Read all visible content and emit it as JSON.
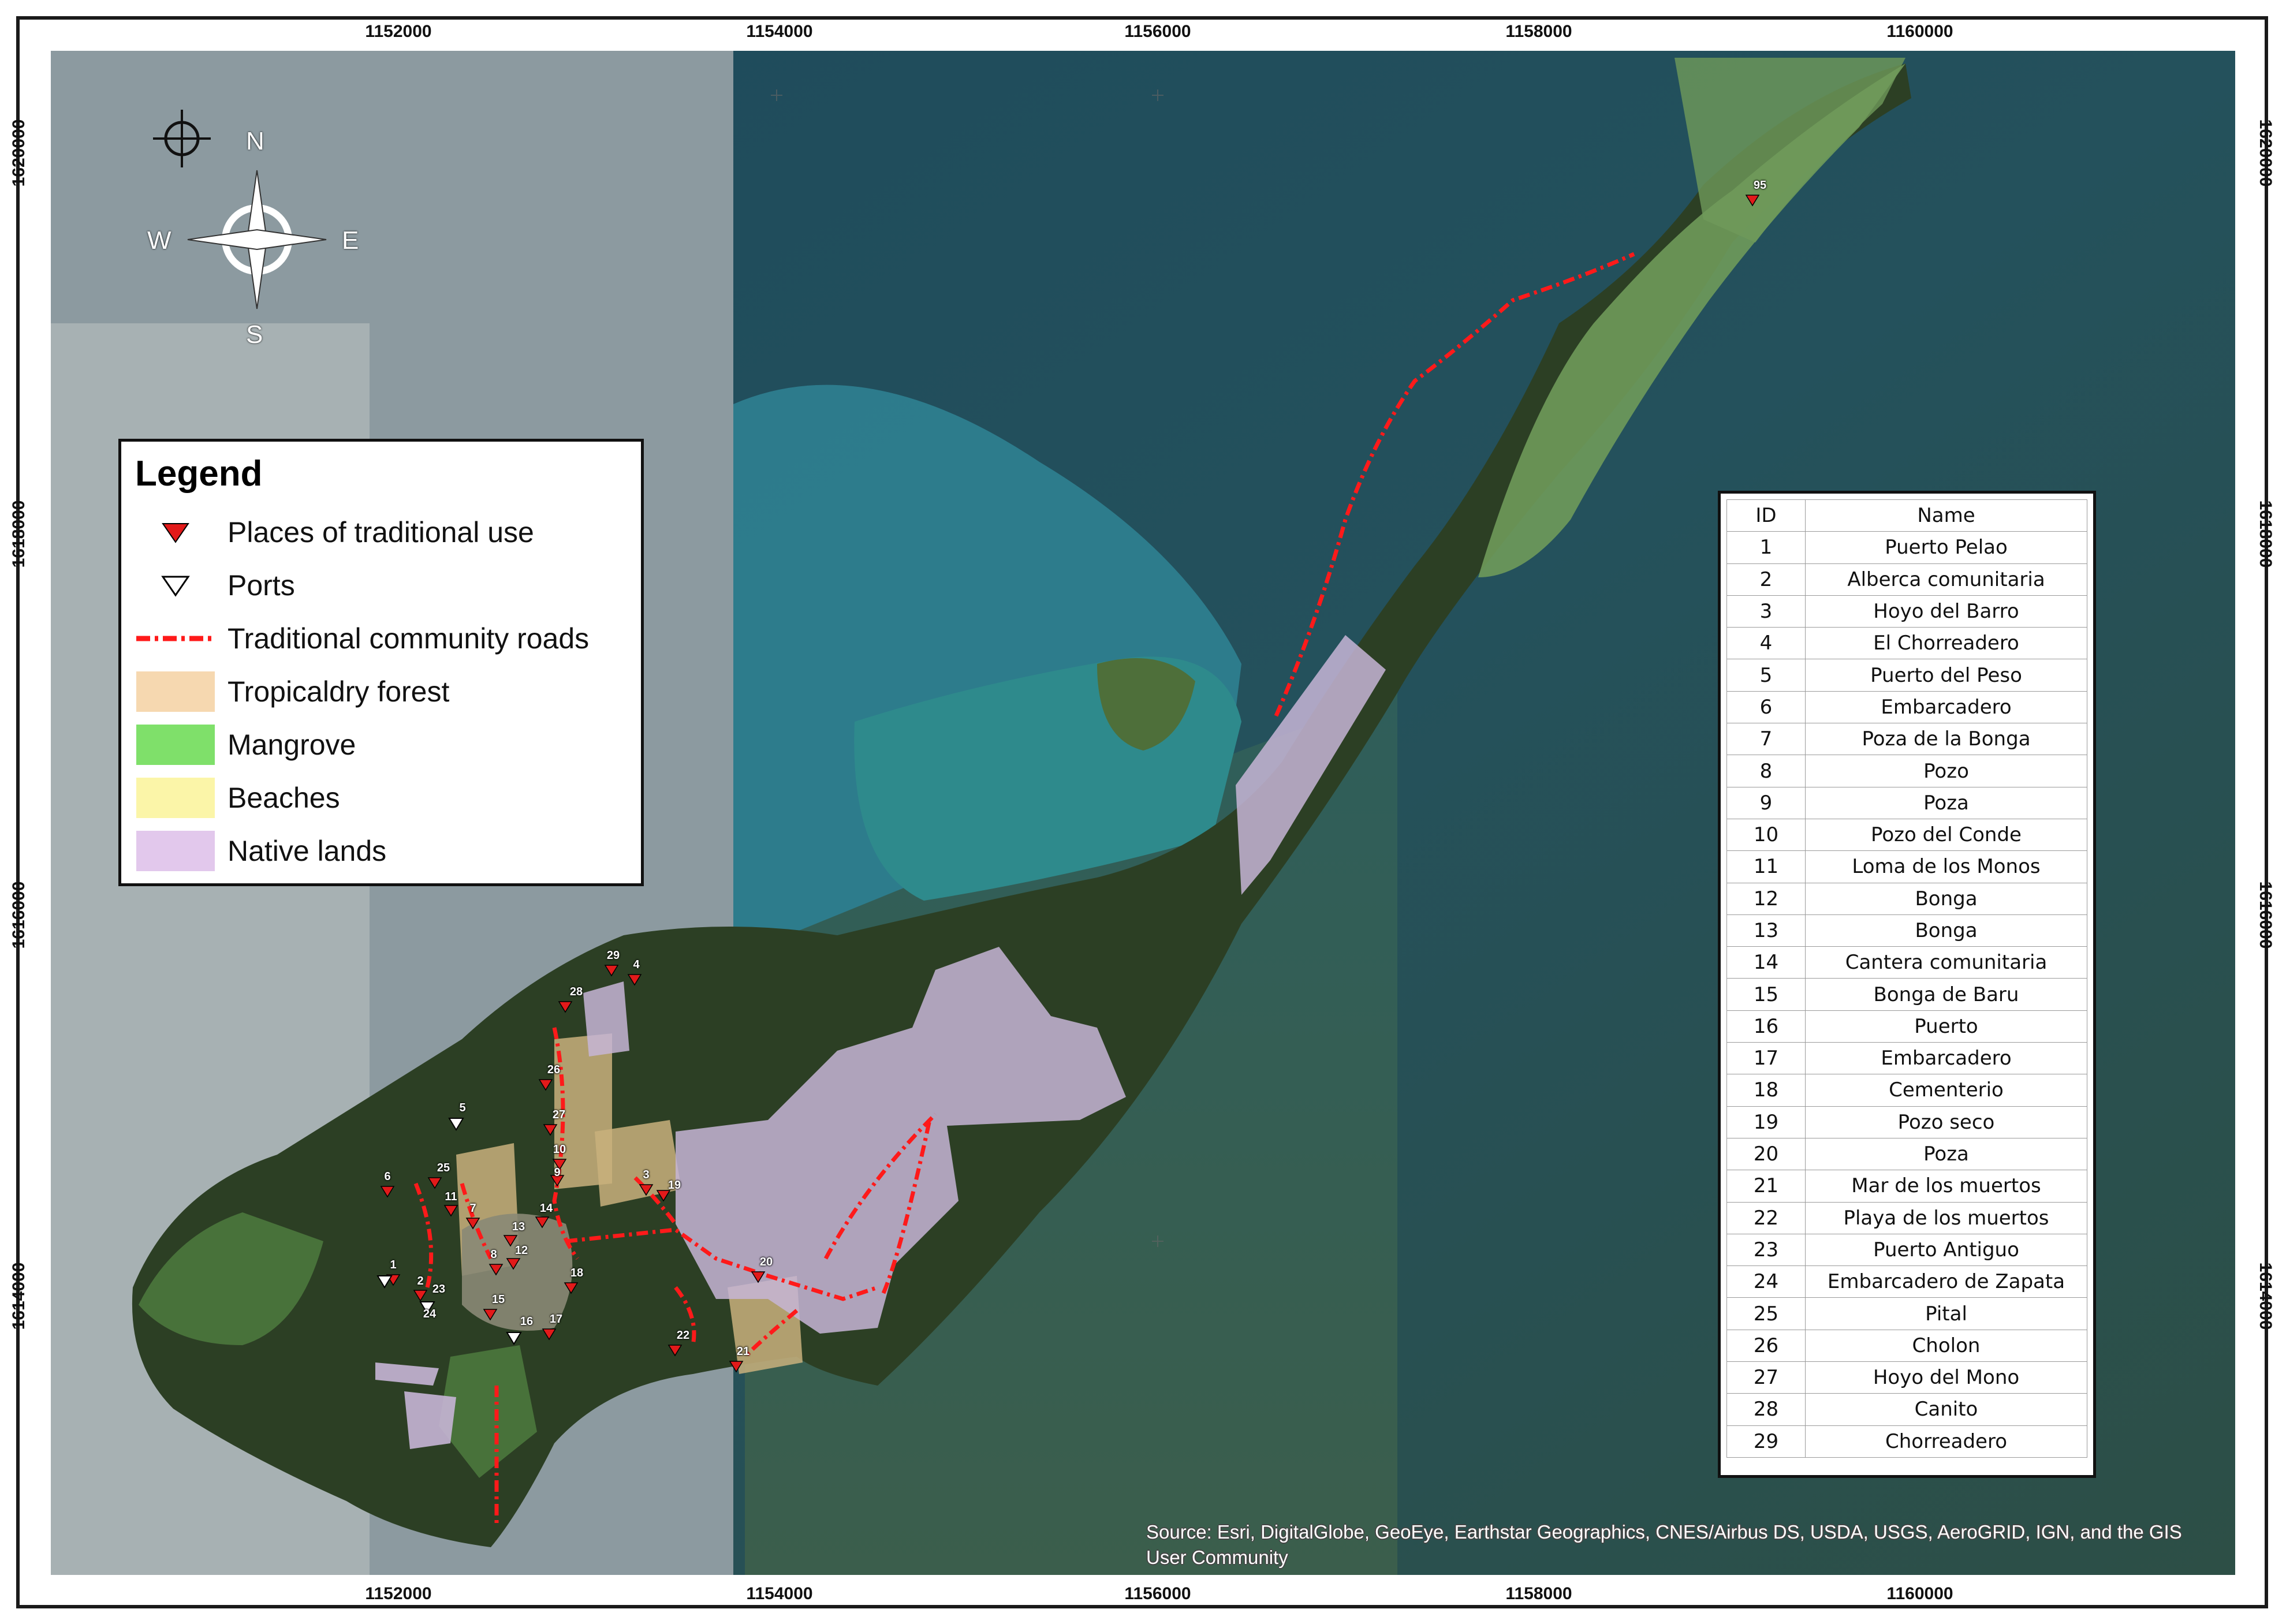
{
  "grid": {
    "x_labels": [
      "1152000",
      "1154000",
      "1156000",
      "1158000",
      "1160000"
    ],
    "y_labels": [
      "1620000",
      "1618000",
      "1616000",
      "1614000"
    ]
  },
  "compass": {
    "n": "N",
    "s": "S",
    "e": "E",
    "w": "W"
  },
  "legend": {
    "title": "Legend",
    "items": [
      {
        "label": "Places of traditional use",
        "symbol": "red-triangle-icon",
        "color": "#e21a1a"
      },
      {
        "label": "Ports",
        "symbol": "white-triangle-icon",
        "color": "#ffffff"
      },
      {
        "label": "Traditional community roads",
        "symbol": "dashed-line-icon",
        "color": "#ff1a1a"
      },
      {
        "label": "Tropicaldry forest",
        "symbol": "swatch",
        "color": "#f6d8b0"
      },
      {
        "label": "Mangrove",
        "symbol": "swatch",
        "color": "#7fe06a"
      },
      {
        "label": "Beaches",
        "symbol": "swatch",
        "color": "#fbf5a8"
      },
      {
        "label": "Native lands",
        "symbol": "swatch",
        "color": "#e2c8ec"
      }
    ]
  },
  "id_table": {
    "headers": [
      "ID",
      "Name"
    ],
    "rows": [
      [
        "1",
        "Puerto Pelao"
      ],
      [
        "2",
        "Alberca comunitaria"
      ],
      [
        "3",
        "Hoyo del Barro"
      ],
      [
        "4",
        "El Chorreadero"
      ],
      [
        "5",
        "Puerto del Peso"
      ],
      [
        "6",
        "Embarcadero"
      ],
      [
        "7",
        "Poza de la Bonga"
      ],
      [
        "8",
        "Pozo"
      ],
      [
        "9",
        "Poza"
      ],
      [
        "10",
        "Pozo del Conde"
      ],
      [
        "11",
        "Loma de los Monos"
      ],
      [
        "12",
        "Bonga"
      ],
      [
        "13",
        "Bonga"
      ],
      [
        "14",
        "Cantera comunitaria"
      ],
      [
        "15",
        "Bonga de Baru"
      ],
      [
        "16",
        "Puerto"
      ],
      [
        "17",
        "Embarcadero"
      ],
      [
        "18",
        "Cementerio"
      ],
      [
        "19",
        "Pozo seco"
      ],
      [
        "20",
        "Poza"
      ],
      [
        "21",
        "Mar de los muertos"
      ],
      [
        "22",
        "Playa de los muertos"
      ],
      [
        "23",
        "Puerto Antiguo"
      ],
      [
        "24",
        "Embarcadero de Zapata"
      ],
      [
        "25",
        "Pital"
      ],
      [
        "26",
        "Cholon"
      ],
      [
        "27",
        "Hoyo del Mono"
      ],
      [
        "28",
        "Canito"
      ],
      [
        "29",
        "Chorreadero"
      ]
    ]
  },
  "place_labels": [
    "1",
    "2",
    "3",
    "4",
    "6",
    "7",
    "8",
    "9",
    "10",
    "11",
    "12",
    "13",
    "14",
    "15",
    "17",
    "18",
    "19",
    "20",
    "21",
    "22",
    "25",
    "26",
    "27",
    "28",
    "29",
    "95"
  ],
  "port_labels": [
    "5",
    "16",
    "23",
    "24"
  ],
  "source": "Source: Esri, DigitalGlobe, GeoEye, Earthstar Geographics, CNES/Airbus DS, USDA, USGS, AeroGRID, IGN, and the GIS User Community"
}
